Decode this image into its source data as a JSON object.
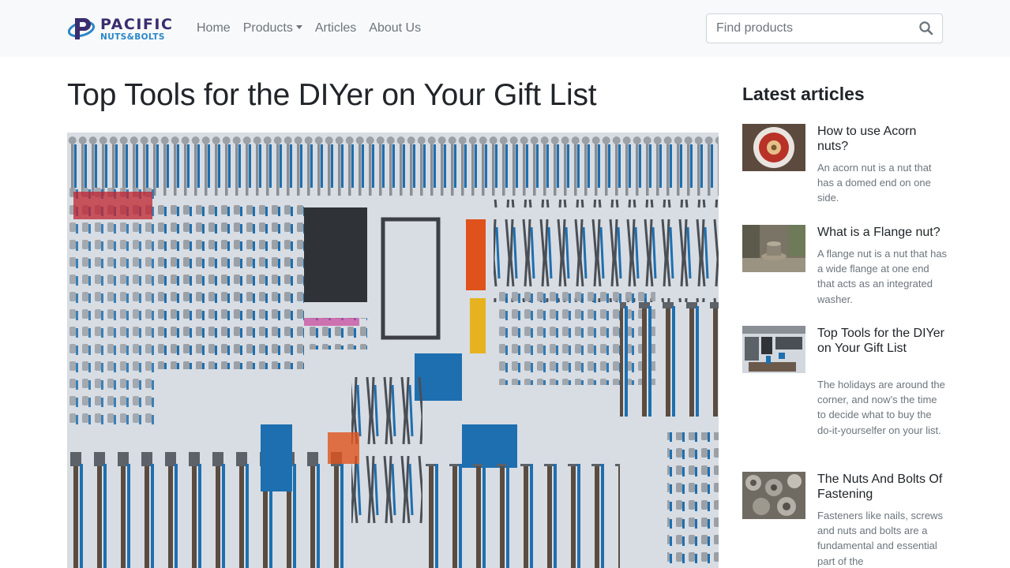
{
  "brand": {
    "name": "PACIFIC",
    "tagline": "NUTS&BOLTS",
    "colors": {
      "primary": "#3a2d6f",
      "accent": "#2a86c9"
    }
  },
  "nav": {
    "items": [
      {
        "label": "Home"
      },
      {
        "label": "Products",
        "has_dropdown": true
      },
      {
        "label": "Articles"
      },
      {
        "label": "About Us"
      }
    ]
  },
  "search": {
    "placeholder": "Find products",
    "value": "",
    "icon": "search-icon"
  },
  "main": {
    "title": "Top Tools for the DIYer on Your Gift List",
    "hero_image": "tool-wall-photo"
  },
  "sidebar": {
    "heading": "Latest articles",
    "articles": [
      {
        "title": "How to use Acorn nuts?",
        "excerpt": "An acorn nut is a nut that has a domed end on one side.",
        "thumb": "acorn-nut-photo"
      },
      {
        "title": "What is a Flange nut?",
        "excerpt": "A flange nut is a nut that has a wide flange at one end that acts as an integrated washer.",
        "thumb": "flange-nut-photo"
      },
      {
        "title": "Top Tools for the DIYer on Your Gift List",
        "excerpt": "The holidays are around the corner, and now’s the time to decide what to buy the do-it-yourselfer on your list.",
        "thumb": "tool-wall-photo"
      },
      {
        "title": "The Nuts And Bolts Of Fastening",
        "excerpt": "Fasteners like nails, screws and nuts and bolts are a fundamental and essential part of the",
        "thumb": "nuts-bolts-photo"
      }
    ]
  }
}
